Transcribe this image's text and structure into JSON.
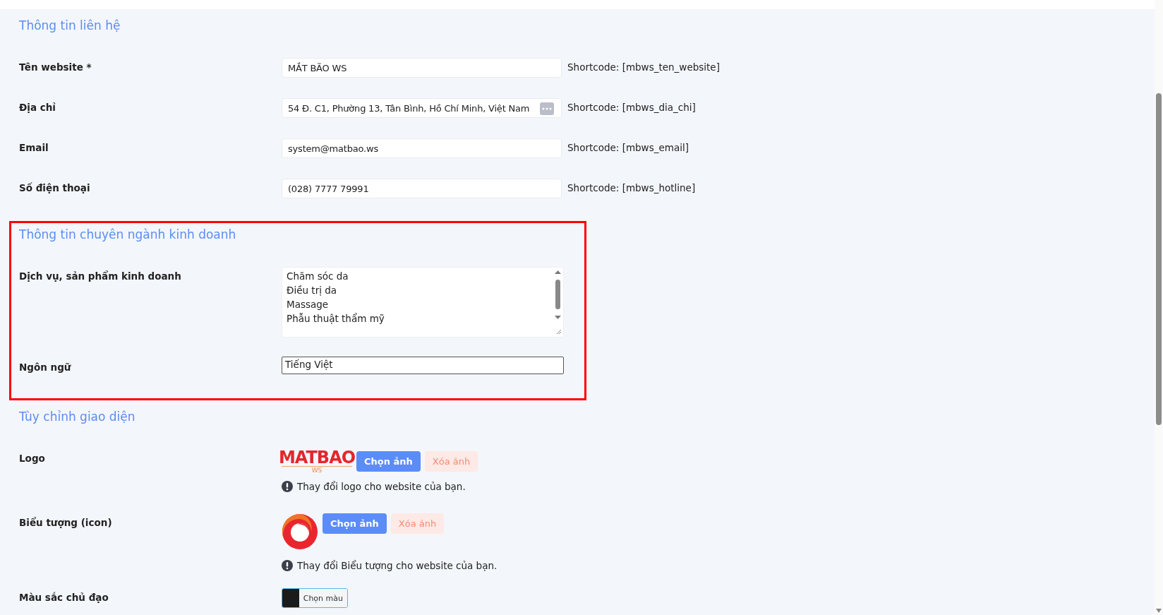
{
  "sections": [
    {
      "title": "Thông tin liên hệ",
      "highlighted": false,
      "fields": [
        {
          "kind": "text",
          "label": "Tên website *",
          "value": "MẮT BÃO WS",
          "shortcode": "Shortcode: [mbws_ten_website]",
          "more_button": false
        },
        {
          "kind": "text",
          "label": "Địa chỉ",
          "value": "54 Đ. C1, Phường 13, Tân Bình, Hồ Chí Minh, Việt Nam",
          "shortcode": "Shortcode: [mbws_dia_chi]",
          "more_button": true
        },
        {
          "kind": "text",
          "label": "Email",
          "value": "system@matbao.ws",
          "shortcode": "Shortcode: [mbws_email]",
          "more_button": false
        },
        {
          "kind": "text",
          "label": "Số điện thoại",
          "value": "(028) 7777 79991",
          "shortcode": "Shortcode: [mbws_hotline]",
          "more_button": false
        }
      ]
    },
    {
      "title": "Thông tin chuyên ngành kinh doanh",
      "highlighted": true,
      "fields": [
        {
          "kind": "textarea",
          "label": "Dịch vụ, sản phẩm kinh doanh",
          "lines": [
            "Chăm sóc da",
            "Điều trị da",
            "Massage",
            "Phẫu thuật thẩm mỹ"
          ]
        },
        {
          "kind": "select",
          "label": "Ngôn ngữ",
          "value": "Tiếng Việt"
        }
      ]
    },
    {
      "title": "Tùy chỉnh giao diện",
      "highlighted": false,
      "fields": [
        {
          "kind": "logo_image",
          "label": "Logo",
          "logo_text": "MATBAO",
          "logo_subtext": "WS",
          "choose": "Chọn ảnh",
          "remove": "Xóa ảnh",
          "hint": "Thay đổi logo cho website của bạn."
        },
        {
          "kind": "icon_image",
          "label": "Biểu tượng (icon)",
          "choose": "Chọn ảnh",
          "remove": "Xóa ảnh",
          "hint": "Thay đổi Biểu tượng cho website của bạn."
        },
        {
          "kind": "color",
          "label": "Màu sắc chủ đạo",
          "color": "#1b1b1b",
          "button": "Chọn màu"
        }
      ]
    }
  ]
}
